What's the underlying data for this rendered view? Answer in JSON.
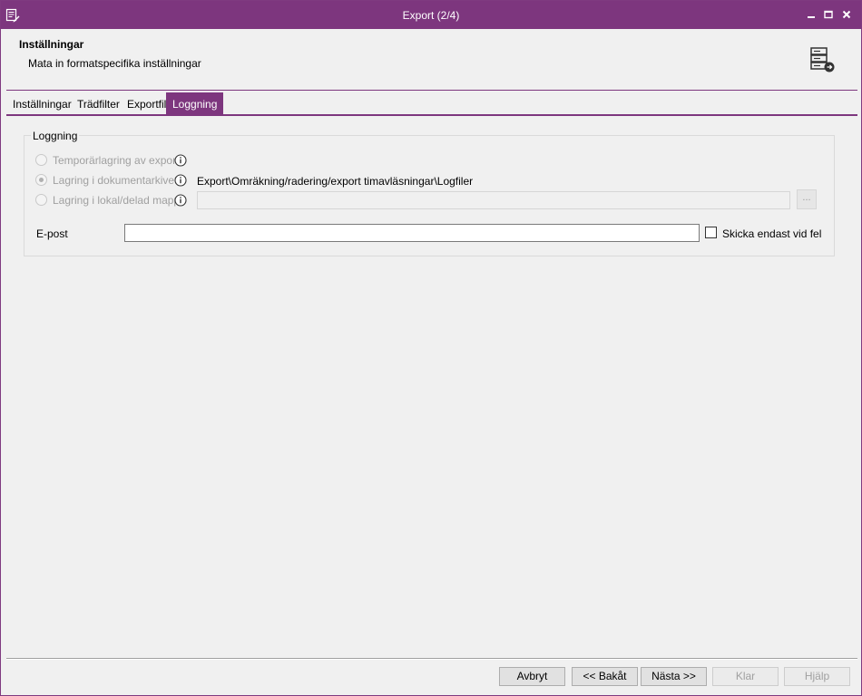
{
  "window": {
    "title": "Export (2/4)",
    "accent_color": "#7d367e",
    "icons": {
      "app": "document-edit-icon",
      "minimize": "minimize-icon",
      "maximize": "maximize-icon",
      "close": "close-icon"
    }
  },
  "header": {
    "title": "Inställningar",
    "subtitle": "Mata in formatspecifika inställningar",
    "icon": "server-export-icon"
  },
  "tabs": [
    {
      "label": "Inställningar",
      "active": false
    },
    {
      "label": "Trädfilter",
      "active": false
    },
    {
      "label": "Exportfil",
      "active": false
    },
    {
      "label": "Loggning",
      "active": true
    }
  ],
  "logging": {
    "group_label": "Loggning",
    "options": [
      {
        "label": "Temporärlagring av export",
        "checked": false,
        "enabled": false,
        "icon": "info-icon"
      },
      {
        "label": "Lagring i dokumentarkivet",
        "checked": true,
        "enabled": false,
        "icon": "info-icon"
      },
      {
        "label": "Lagring i lokal/delad mapp",
        "checked": false,
        "enabled": false,
        "icon": "info-icon"
      }
    ],
    "archive_path": "Export\\Omräkning/radering/export timavläsningar\\Logfiler",
    "folder_value": "",
    "browse_label": "...",
    "email_label": "E-post",
    "email_value": "",
    "only_on_error_label": "Skicka endast vid fel",
    "only_on_error_checked": false
  },
  "footer": {
    "cancel": "Avbryt",
    "back": "<< Bakåt",
    "next": "Nästa >>",
    "finish": "Klar",
    "help": "Hjälp"
  }
}
